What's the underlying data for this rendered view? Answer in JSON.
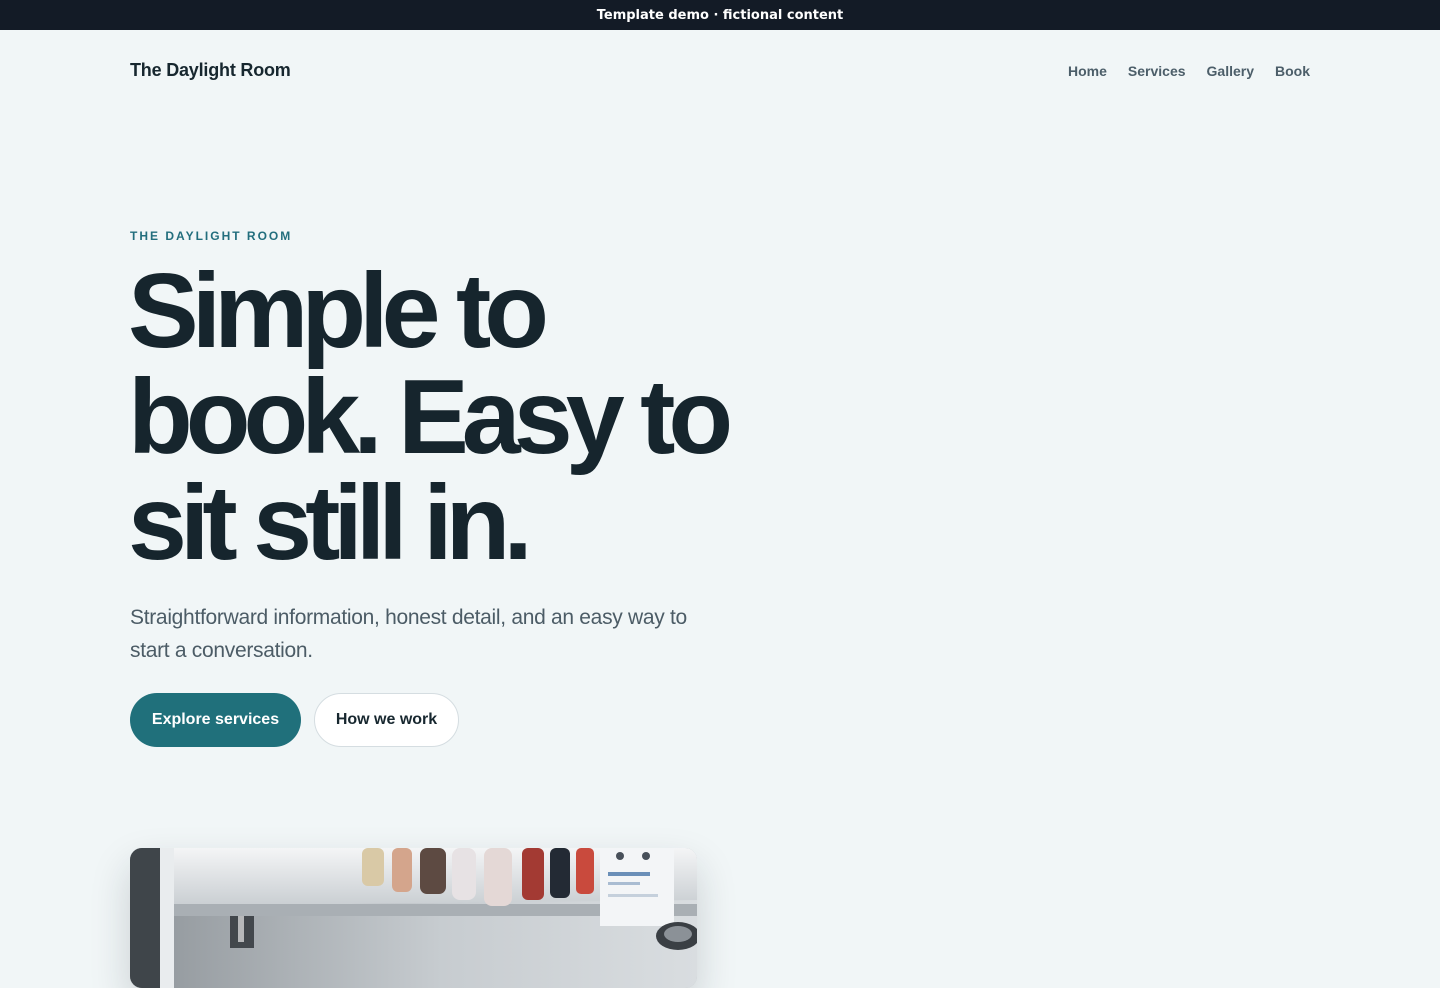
{
  "banner": {
    "text": "Template demo · fictional content"
  },
  "header": {
    "brand": "The Daylight Room",
    "nav": [
      {
        "label": "Home"
      },
      {
        "label": "Services"
      },
      {
        "label": "Gallery"
      },
      {
        "label": "Book"
      }
    ]
  },
  "hero": {
    "eyebrow": "THE DAYLIGHT ROOM",
    "title": "Simple to book. Easy to sit still in.",
    "subtitle": "Straightforward information, honest detail, and an easy way to start a conversation.",
    "primary_cta": "Explore services",
    "secondary_cta": "How we work",
    "image": "photo of a white shelf with bottles and a printed card"
  },
  "colors": {
    "background": "#f1f6f7",
    "banner": "#131b26",
    "text": "#16252d",
    "muted": "#4c5c66",
    "accent": "#20707b",
    "eyebrow": "#226e7d"
  }
}
